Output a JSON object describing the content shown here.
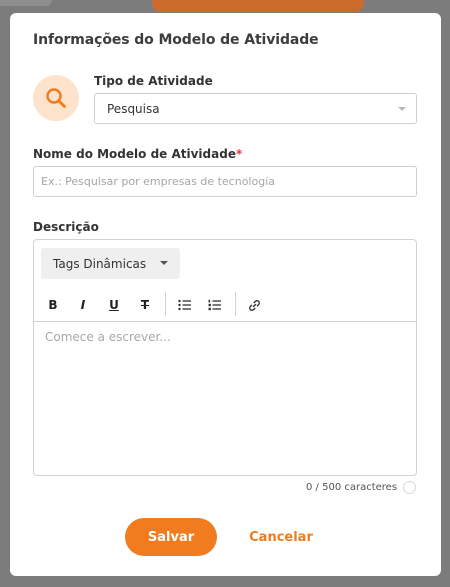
{
  "modal": {
    "title": "Informações do Modelo de Atividade",
    "activity_type": {
      "label": "Tipo de Atividade",
      "value": "Pesquisa",
      "icon": "search-icon"
    },
    "name_field": {
      "label": "Nome do Modelo de Atividade",
      "required_mark": "*",
      "value": "",
      "placeholder": "Ex.: Pesquisar por empresas de tecnologia"
    },
    "description": {
      "label": "Descrição",
      "tags_button_label": "Tags Dinâmicas",
      "toolbar": {
        "bold": "B",
        "italic": "I",
        "underline": "U",
        "strikethrough": "T"
      },
      "placeholder": "Comece a escrever...",
      "counter": "0 / 500 caracteres"
    },
    "actions": {
      "save_label": "Salvar",
      "cancel_label": "Cancelar"
    }
  },
  "colors": {
    "accent": "#f07c1f",
    "icon_bg": "#fde3cc",
    "required": "#e53935"
  }
}
